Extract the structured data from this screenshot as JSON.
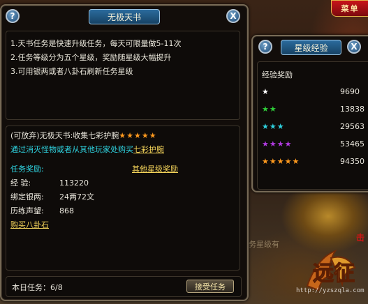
{
  "corner_button": {
    "label": "菜单"
  },
  "background": {
    "hint": "您刷新任务星级有",
    "red_tag": "击",
    "logo": "远征",
    "watermark": "http://yzszqla.com"
  },
  "quest_panel": {
    "title": "无极天书",
    "help_icon": "?",
    "close_icon": "X",
    "description": [
      "1.天书任务是快速升级任务，每天可限量做5-11次",
      "2.任务等级分为五个星级，奖励随星级大幅提升",
      "3.可用银两或者八卦石刷新任务星级"
    ],
    "task": {
      "prefix": "(可放弃)无极天书:收集七彩护腕",
      "stars": "★★★★★",
      "star_color": "#ff9a1e"
    },
    "instruction": {
      "text": "通过消灭怪物或者从其他玩家处购买",
      "link": "七彩护腕"
    },
    "reward_label": "任务奖励:",
    "other_rewards_link": "其他星级奖励",
    "rewards": [
      {
        "label": "经      验:",
        "value": "113220"
      },
      {
        "label": "绑定银两:",
        "value": "24两72文"
      },
      {
        "label": "历练声望:",
        "value": "868"
      }
    ],
    "buy_link": "购买八卦石",
    "daily_count": "本日任务：6/8",
    "accept_button": "接受任务"
  },
  "exp_panel": {
    "title": "星级经验",
    "help_icon": "?",
    "close_icon": "X",
    "header": "经验奖励",
    "levels": [
      {
        "stars": "★",
        "color": "#ffffff",
        "value": "9690"
      },
      {
        "stars": "★★",
        "color": "#2fcf3a",
        "value": "13838"
      },
      {
        "stars": "★★★",
        "color": "#2fd3e0",
        "value": "29563"
      },
      {
        "stars": "★★★★",
        "color": "#b13be0",
        "value": "53465"
      },
      {
        "stars": "★★★★★",
        "color": "#ff9a1e",
        "value": "94350"
      }
    ]
  }
}
